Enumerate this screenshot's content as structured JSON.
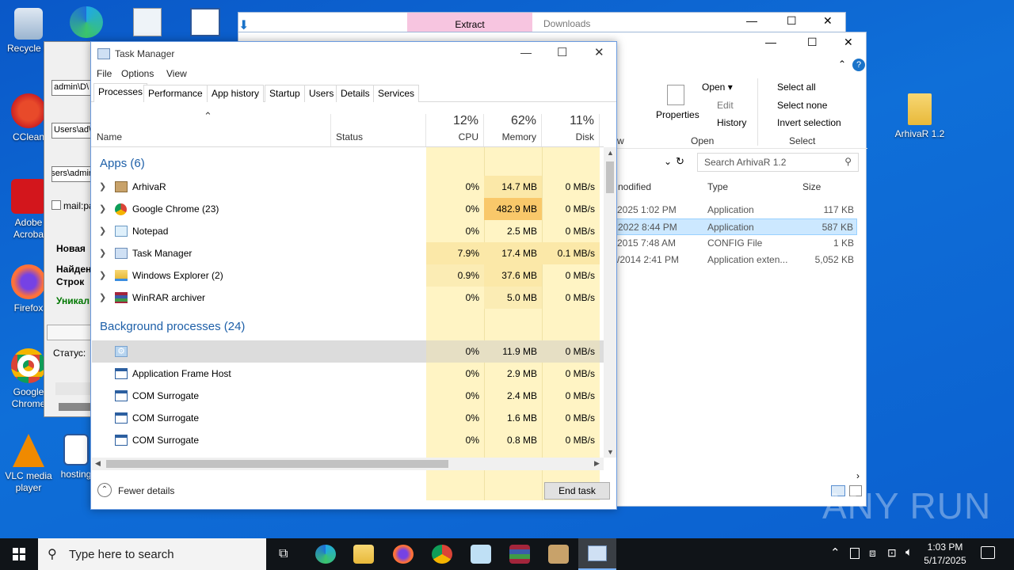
{
  "desktop": {
    "icons": [
      {
        "label": "Recycle B",
        "icon": "recycle-bin-icon"
      },
      {
        "label": "CClean",
        "icon": "ccleaner-icon"
      },
      {
        "label": "Adobe Acroba",
        "icon": "acrobat-icon"
      },
      {
        "label": "Firefox",
        "icon": "firefox-icon"
      },
      {
        "label": "Google Chrome",
        "icon": "chrome-icon"
      },
      {
        "label": "VLC media player",
        "icon": "vlc-icon"
      },
      {
        "label": "hosting",
        "icon": "word-doc-icon"
      },
      {
        "label": "ArhivaR 1.2",
        "icon": "folder-icon"
      }
    ]
  },
  "explorer": {
    "extract_tab": "Extract",
    "downloads_title": "Downloads",
    "ribbon": {
      "properties": "Properties",
      "open": "Open",
      "edit": "Edit",
      "history": "History",
      "select_all": "Select all",
      "select_none": "Select none",
      "invert_selection": "Invert selection",
      "group_open": "Open",
      "group_select": "Select",
      "group_view_partial": "w"
    },
    "search_placeholder": "Search ArhivaR 1.2",
    "columns": {
      "modified": "nodified",
      "type": "Type",
      "size": "Size"
    },
    "files": [
      {
        "date": "2025 1:02 PM",
        "type": "Application",
        "size": "117 KB"
      },
      {
        "date": "2022 8:44 PM",
        "type": "Application",
        "size": "587 KB"
      },
      {
        "date": "2015 7:48 AM",
        "type": "CONFIG File",
        "size": "1 KB"
      },
      {
        "date": "/2014 2:41 PM",
        "type": "Application exten...",
        "size": "5,052 KB"
      }
    ]
  },
  "leftwin": {
    "field1": "\\admin\\D",
    "field2": "\\Users\\ad",
    "field3": "sers\\admin",
    "check_label": "mail:pa",
    "new_label": "Новая",
    "found_label": "Найден",
    "rows_label": "Строк",
    "unique_label": "Уникал",
    "status_label": "Статус:"
  },
  "taskmanager": {
    "title": "Task Manager",
    "menu": [
      "File",
      "Options",
      "View"
    ],
    "tabs": [
      "Processes",
      "Performance",
      "App history",
      "Startup",
      "Users",
      "Details",
      "Services"
    ],
    "columns": {
      "name": "Name",
      "status": "Status",
      "cpu_pct": "12%",
      "cpu": "CPU",
      "mem_pct": "62%",
      "mem": "Memory",
      "disk_pct": "11%",
      "disk": "Disk"
    },
    "apps_header": "Apps (6)",
    "apps": [
      {
        "name": "ArhivaR",
        "cpu": "0%",
        "mem": "14.7 MB",
        "disk": "0 MB/s",
        "icon": "package-icon"
      },
      {
        "name": "Google Chrome (23)",
        "cpu": "0%",
        "mem": "482.9 MB",
        "disk": "0 MB/s",
        "icon": "chrome-icon"
      },
      {
        "name": "Notepad",
        "cpu": "0%",
        "mem": "2.5 MB",
        "disk": "0 MB/s",
        "icon": "notepad-icon"
      },
      {
        "name": "Task Manager",
        "cpu": "7.9%",
        "mem": "17.4 MB",
        "disk": "0.1 MB/s",
        "icon": "task-manager-icon"
      },
      {
        "name": "Windows Explorer (2)",
        "cpu": "0.9%",
        "mem": "37.6 MB",
        "disk": "0 MB/s",
        "icon": "explorer-icon"
      },
      {
        "name": "WinRAR archiver",
        "cpu": "0%",
        "mem": "5.0 MB",
        "disk": "0 MB/s",
        "icon": "winrar-icon"
      }
    ],
    "bg_header": "Background processes (24)",
    "bg": [
      {
        "name": "",
        "cpu": "0%",
        "mem": "11.9 MB",
        "disk": "0 MB/s",
        "icon": "gear-icon"
      },
      {
        "name": "Application Frame Host",
        "cpu": "0%",
        "mem": "2.9 MB",
        "disk": "0 MB/s",
        "icon": "app-frame-icon"
      },
      {
        "name": "COM Surrogate",
        "cpu": "0%",
        "mem": "2.4 MB",
        "disk": "0 MB/s",
        "icon": "app-frame-icon"
      },
      {
        "name": "COM Surrogate",
        "cpu": "0%",
        "mem": "1.6 MB",
        "disk": "0 MB/s",
        "icon": "app-frame-icon"
      },
      {
        "name": "COM Surrogate",
        "cpu": "0%",
        "mem": "0.8 MB",
        "disk": "0 MB/s",
        "icon": "app-frame-icon"
      }
    ],
    "fewer_details": "Fewer details",
    "end_task": "End task"
  },
  "taskbar": {
    "search_placeholder": "Type here to search",
    "time": "1:03 PM",
    "date": "5/17/2025"
  },
  "watermark": "ANY RUN"
}
